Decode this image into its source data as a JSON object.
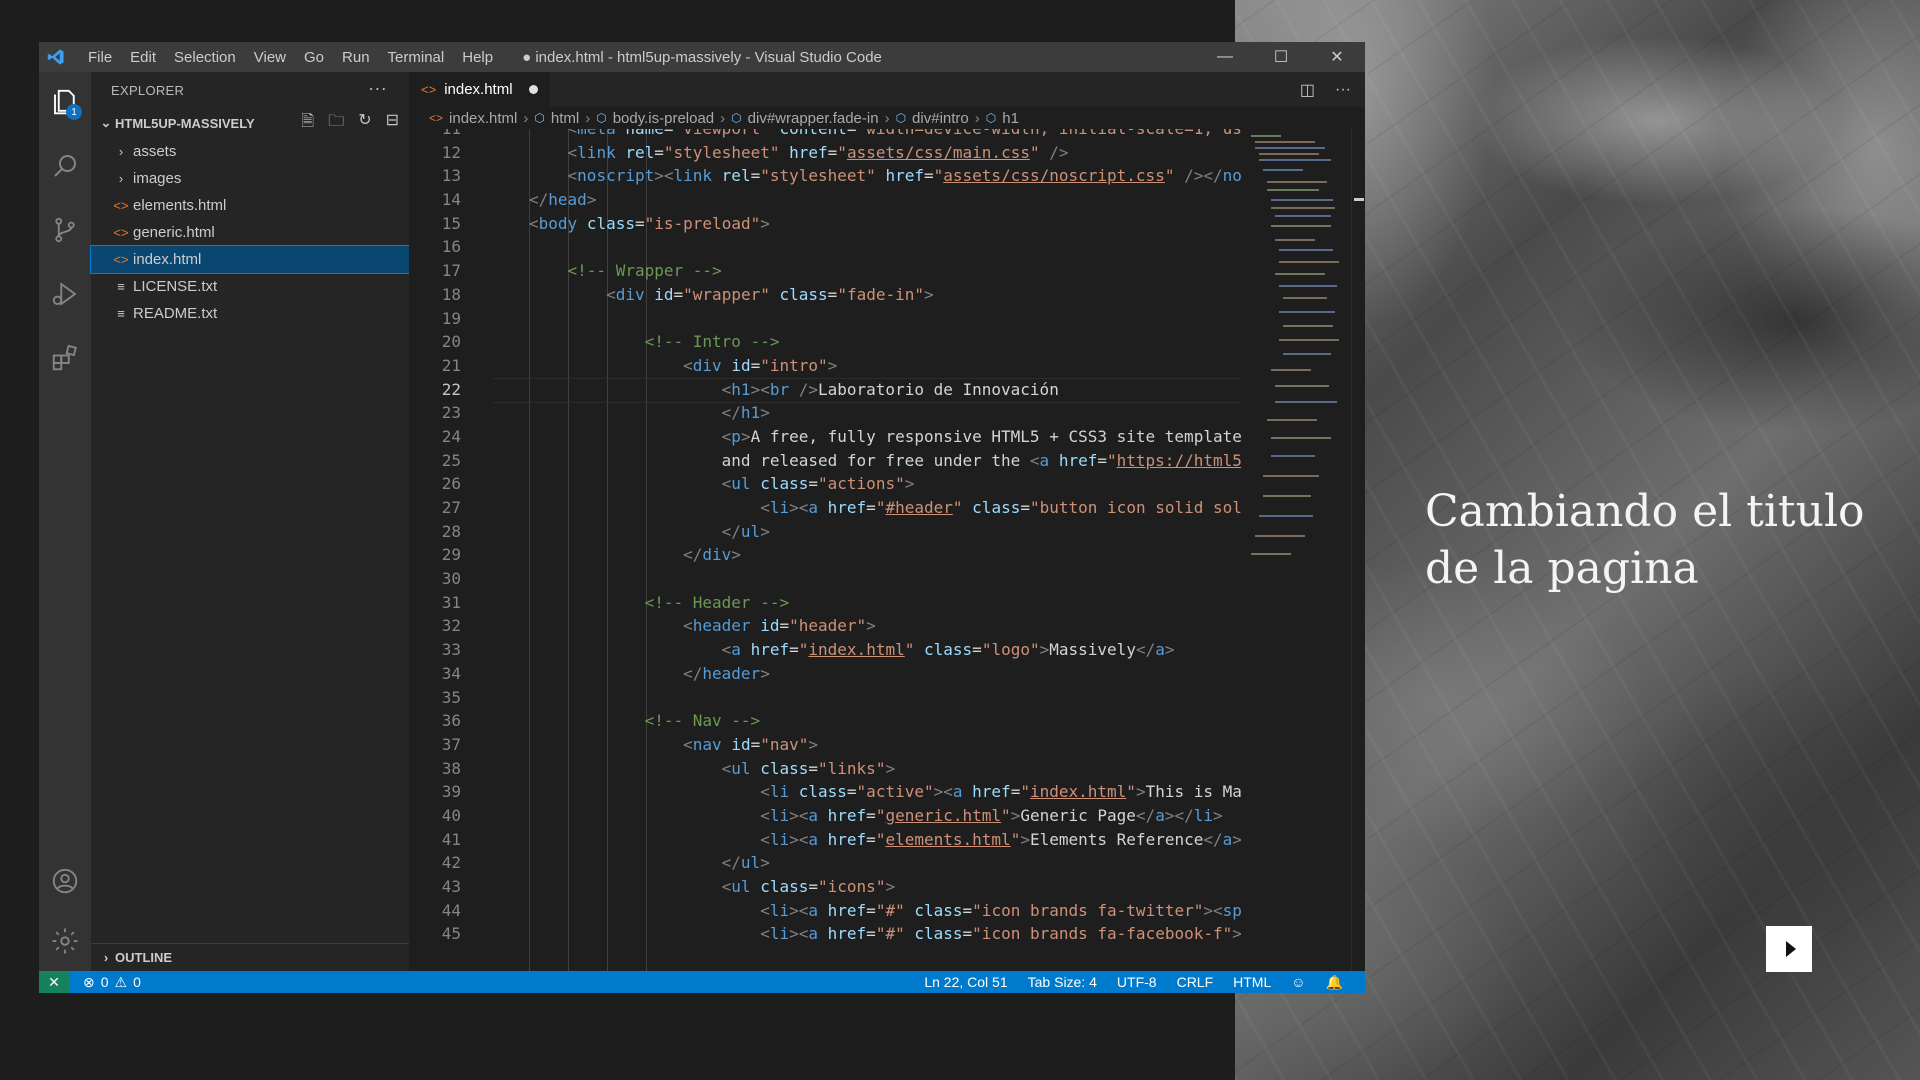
{
  "window": {
    "title": "● index.html - html5up-massively - Visual Studio Code",
    "menu": [
      "File",
      "Edit",
      "Selection",
      "View",
      "Go",
      "Run",
      "Terminal",
      "Help"
    ]
  },
  "activity_bar": {
    "explorer_badge": "1"
  },
  "sidebar": {
    "header": "EXPLORER",
    "folder": "HTML5UP-MASSIVELY",
    "items": [
      {
        "label": "assets",
        "kind": "folder"
      },
      {
        "label": "images",
        "kind": "folder"
      },
      {
        "label": "elements.html",
        "kind": "html"
      },
      {
        "label": "generic.html",
        "kind": "html"
      },
      {
        "label": "index.html",
        "kind": "html",
        "selected": true
      },
      {
        "label": "LICENSE.txt",
        "kind": "txt"
      },
      {
        "label": "README.txt",
        "kind": "txt"
      }
    ],
    "outline": "OUTLINE"
  },
  "editor": {
    "tab_label": "index.html",
    "breadcrumbs": [
      "index.html",
      "html",
      "body.is-preload",
      "div#wrapper.fade-in",
      "div#intro",
      "h1"
    ],
    "line_numbers": [
      "11",
      "12",
      "13",
      "14",
      "15",
      "16",
      "17",
      "18",
      "19",
      "20",
      "21",
      "22",
      "23",
      "24",
      "25",
      "26",
      "27",
      "28",
      "29",
      "30",
      "31",
      "32",
      "33",
      "34",
      "35",
      "36",
      "37",
      "38",
      "39",
      "40",
      "41",
      "42",
      "43",
      "44",
      "45"
    ],
    "current_line": "22"
  },
  "status_bar": {
    "errors": "0",
    "warnings": "0",
    "position": "Ln 22, Col 51",
    "tab_size": "Tab Size: 4",
    "encoding": "UTF-8",
    "eol": "CRLF",
    "language": "HTML"
  },
  "overlay": {
    "caption": "Cambiando el titulo de la pagina"
  }
}
